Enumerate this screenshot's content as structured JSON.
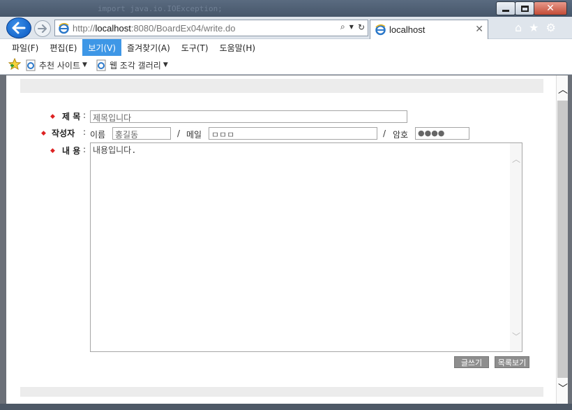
{
  "browser": {
    "url_prefix": "http://",
    "url_host": "localhost",
    "url_rest": ":8080/BoardEx04/write.do",
    "tab_title": "localhost",
    "background_code": "import java.io.IOException;"
  },
  "menu": [
    {
      "label": "파일(F)"
    },
    {
      "label": "편집(E)"
    },
    {
      "label": "보기(V)"
    },
    {
      "label": "즐겨찾기(A)"
    },
    {
      "label": "도구(T)"
    },
    {
      "label": "도움말(H)"
    }
  ],
  "favorites": [
    {
      "label": "추천 사이트"
    },
    {
      "label": "웹 조각 갤러리"
    }
  ],
  "form": {
    "subject_label": "제 목",
    "subject_value": "제목입니다",
    "writer_label": "작성자",
    "name_label": "이름",
    "name_value": "홍길동",
    "separator": "/",
    "email_label": "메일",
    "email_value": "ㅁㅁㅁ",
    "password_label": "암호",
    "password_value": "●●●●",
    "content_label": "내 용",
    "content_value": "내용입니다.",
    "colon": ":"
  },
  "buttons": {
    "write": "글쓰기",
    "list": "목록보기"
  },
  "colors": {
    "accent": "#3e97e6",
    "required_bullet": "#dd2222",
    "button_bg": "#8e8e8e"
  }
}
